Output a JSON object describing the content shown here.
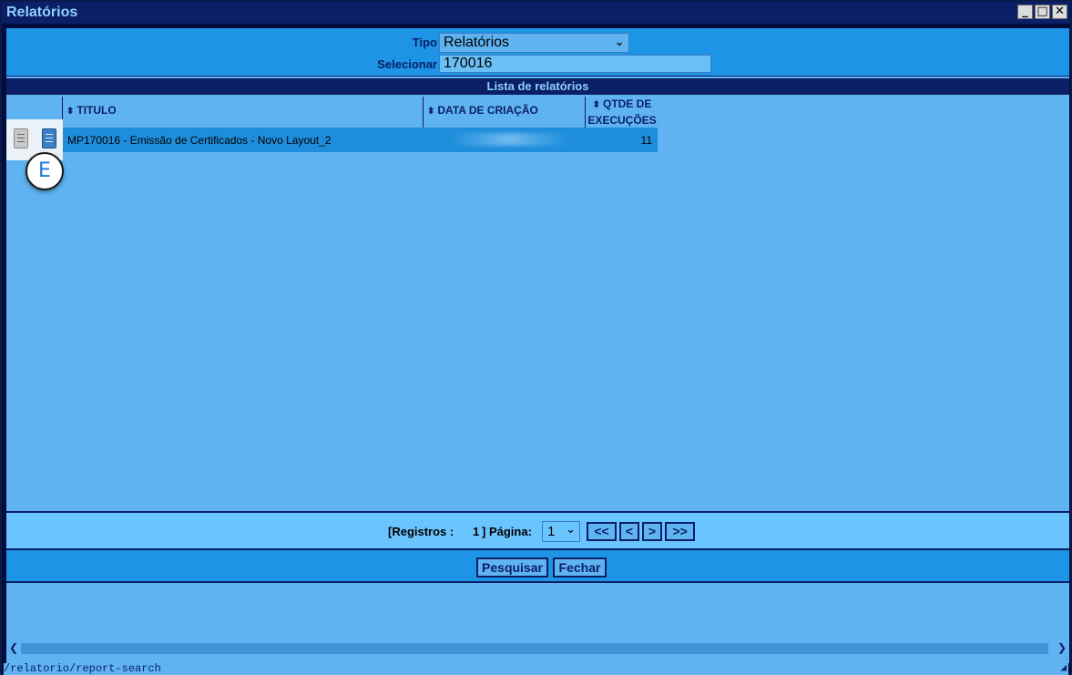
{
  "window": {
    "title": "Relatórios"
  },
  "filter": {
    "tipo_label": "Tipo",
    "tipo_value": "Relatórios",
    "selecionar_label": "Selecionar",
    "selecionar_value": "170016"
  },
  "list": {
    "header": "Lista de relatórios",
    "columns": [
      "TITULO",
      "DATA DE CRIAÇÃO",
      "QTDE DE EXECUÇÕES"
    ],
    "rows": [
      {
        "titulo": "MP170016 - Emissão de Certificados - Novo Layout_2",
        "qtde": "11"
      }
    ]
  },
  "annotation_badge": "E",
  "pager": {
    "registros_label": "[Registros :",
    "registros_count": "1",
    "pagina_label": "] Página:",
    "pagina_value": "1",
    "first": "<<",
    "prev": "<",
    "next": ">",
    "last": ">>"
  },
  "actions": {
    "pesquisar": "Pesquisar",
    "fechar": "Fechar"
  },
  "status_url": "/relatorio/report-search",
  "colors": {
    "titlebar": "#0a1f66",
    "panel": "#5fb3f0",
    "accent": "#1e94e6"
  }
}
